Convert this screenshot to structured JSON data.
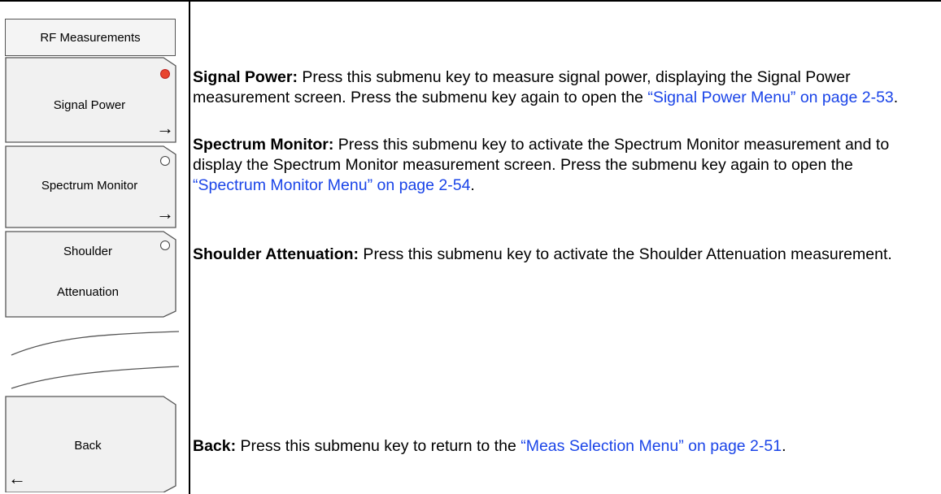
{
  "menu": {
    "title": "RF Measurements",
    "keys": [
      {
        "label": "Signal Power",
        "indicator": "active",
        "arrow": "→"
      },
      {
        "label": "Spectrum Monitor",
        "indicator": "inactive",
        "arrow": "→"
      },
      {
        "label_line1": "Shoulder",
        "label_line2": "Attenuation",
        "indicator": "inactive"
      }
    ],
    "back": {
      "label": "Back",
      "arrow": "←"
    }
  },
  "descriptions": {
    "signal_power": {
      "term": "Signal Power:",
      "text": " Press this submenu key to measure signal power, displaying the Signal Power measurement screen. Press the submenu key again to open the ",
      "link": "“Signal Power Menu” on page 2-53",
      "end": "."
    },
    "spectrum_monitor": {
      "term": "Spectrum Monitor:",
      "text": " Press this submenu key to activate the Spectrum Monitor measurement and to display the Spectrum Monitor measurement screen. Press the submenu key again to open the ",
      "link": "“Spectrum Monitor Menu” on page 2-54",
      "end": "."
    },
    "shoulder_attenuation": {
      "term": "Shoulder Attenuation:",
      "text": " Press this submenu key to activate the Shoulder Attenuation measurement."
    },
    "back": {
      "term": "Back:",
      "text": " Press this submenu key to return to the ",
      "link": "“Meas Selection Menu” on page 2-51",
      "end": "."
    }
  },
  "colors": {
    "active_indicator": "#e8442e",
    "link": "#1a44e8"
  }
}
